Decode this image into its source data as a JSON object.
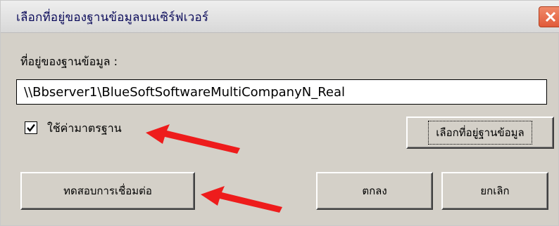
{
  "window": {
    "title": "เลือกที่อยู่ของฐานข้อมูลบนเซิร์ฟเวอร์"
  },
  "form": {
    "path_label": "ที่อยู่ของฐานข้อมูล :",
    "path_value": "\\\\Bbserver1\\BlueSoftSoftwareMultiCompanyN_Real",
    "default_checkbox_label": "ใช้ค่ามาตรฐาน",
    "default_checked": true
  },
  "buttons": {
    "browse": "เลือกที่อยู่ฐานข้อมูล",
    "test_connection": "ทดสอบการเชื่อมต่อ",
    "ok": "ตกลง",
    "cancel": "ยกเลิก"
  },
  "colors": {
    "dialog_bg": "#d4d0c8",
    "arrow": "#ee1c1c"
  }
}
